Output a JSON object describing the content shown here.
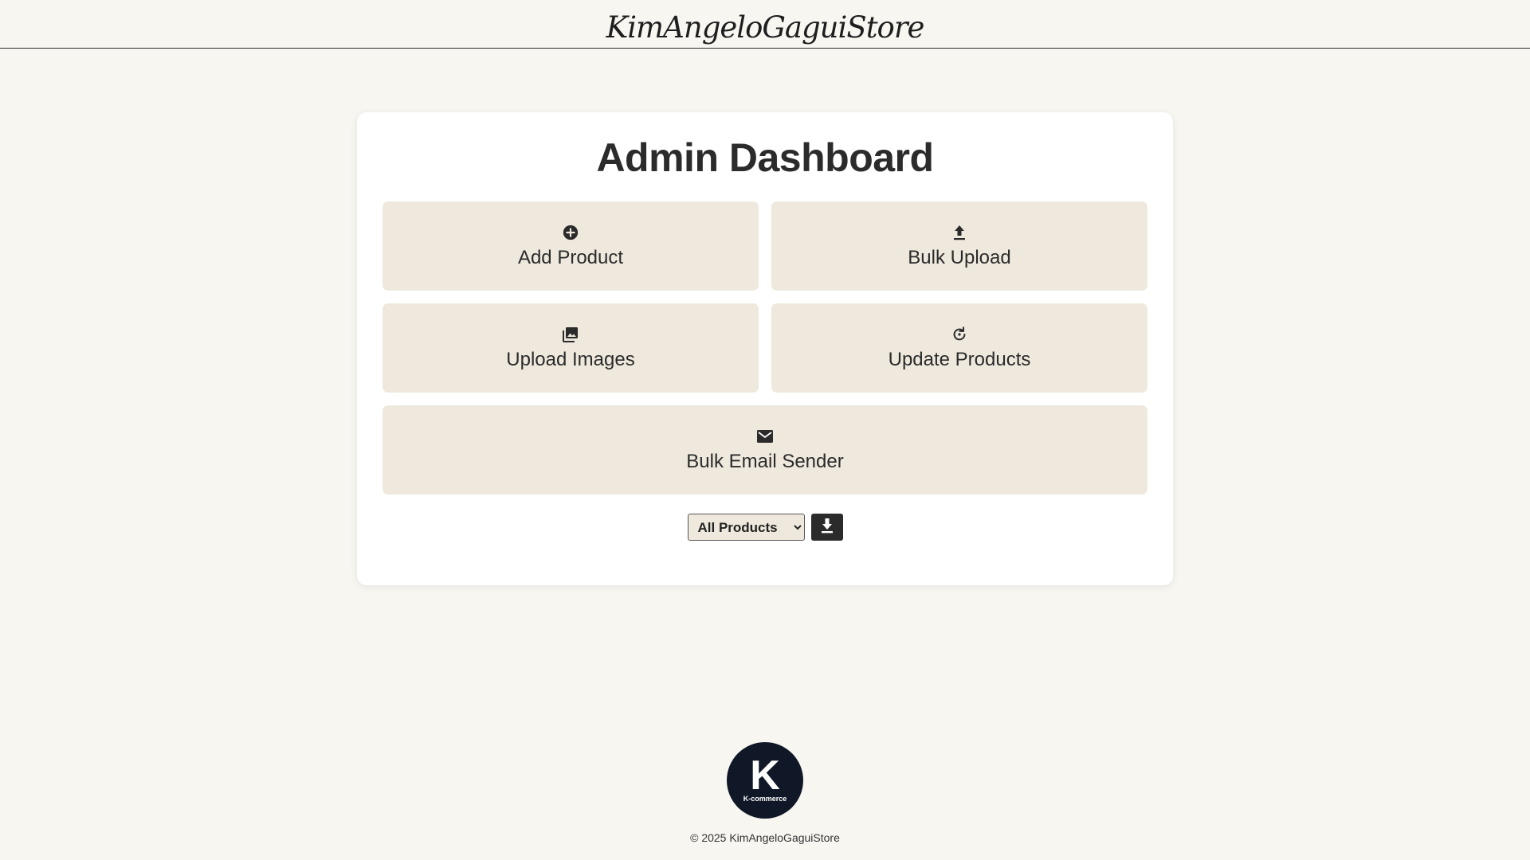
{
  "header": {
    "brand": "KimAngeloGaguiStore"
  },
  "dashboard": {
    "title": "Admin Dashboard",
    "tiles": [
      {
        "label": "Add Product",
        "icon": "plus-circle-icon"
      },
      {
        "label": "Bulk Upload",
        "icon": "upload-icon"
      },
      {
        "label": "Upload Images",
        "icon": "images-icon"
      },
      {
        "label": "Update Products",
        "icon": "refresh-icon"
      },
      {
        "label": "Bulk Email Sender",
        "icon": "envelope-icon"
      }
    ],
    "export": {
      "selected": "All Products",
      "download_icon": "download-icon"
    }
  },
  "footer": {
    "logo_letter": "K",
    "logo_text": "K-commerce",
    "copyright": "© 2025 KimAngeloGaguiStore"
  },
  "colors": {
    "background": "#f8f6f1",
    "tile": "#efe9dd",
    "text": "#2b2b2b",
    "logo_bg": "#101828"
  }
}
